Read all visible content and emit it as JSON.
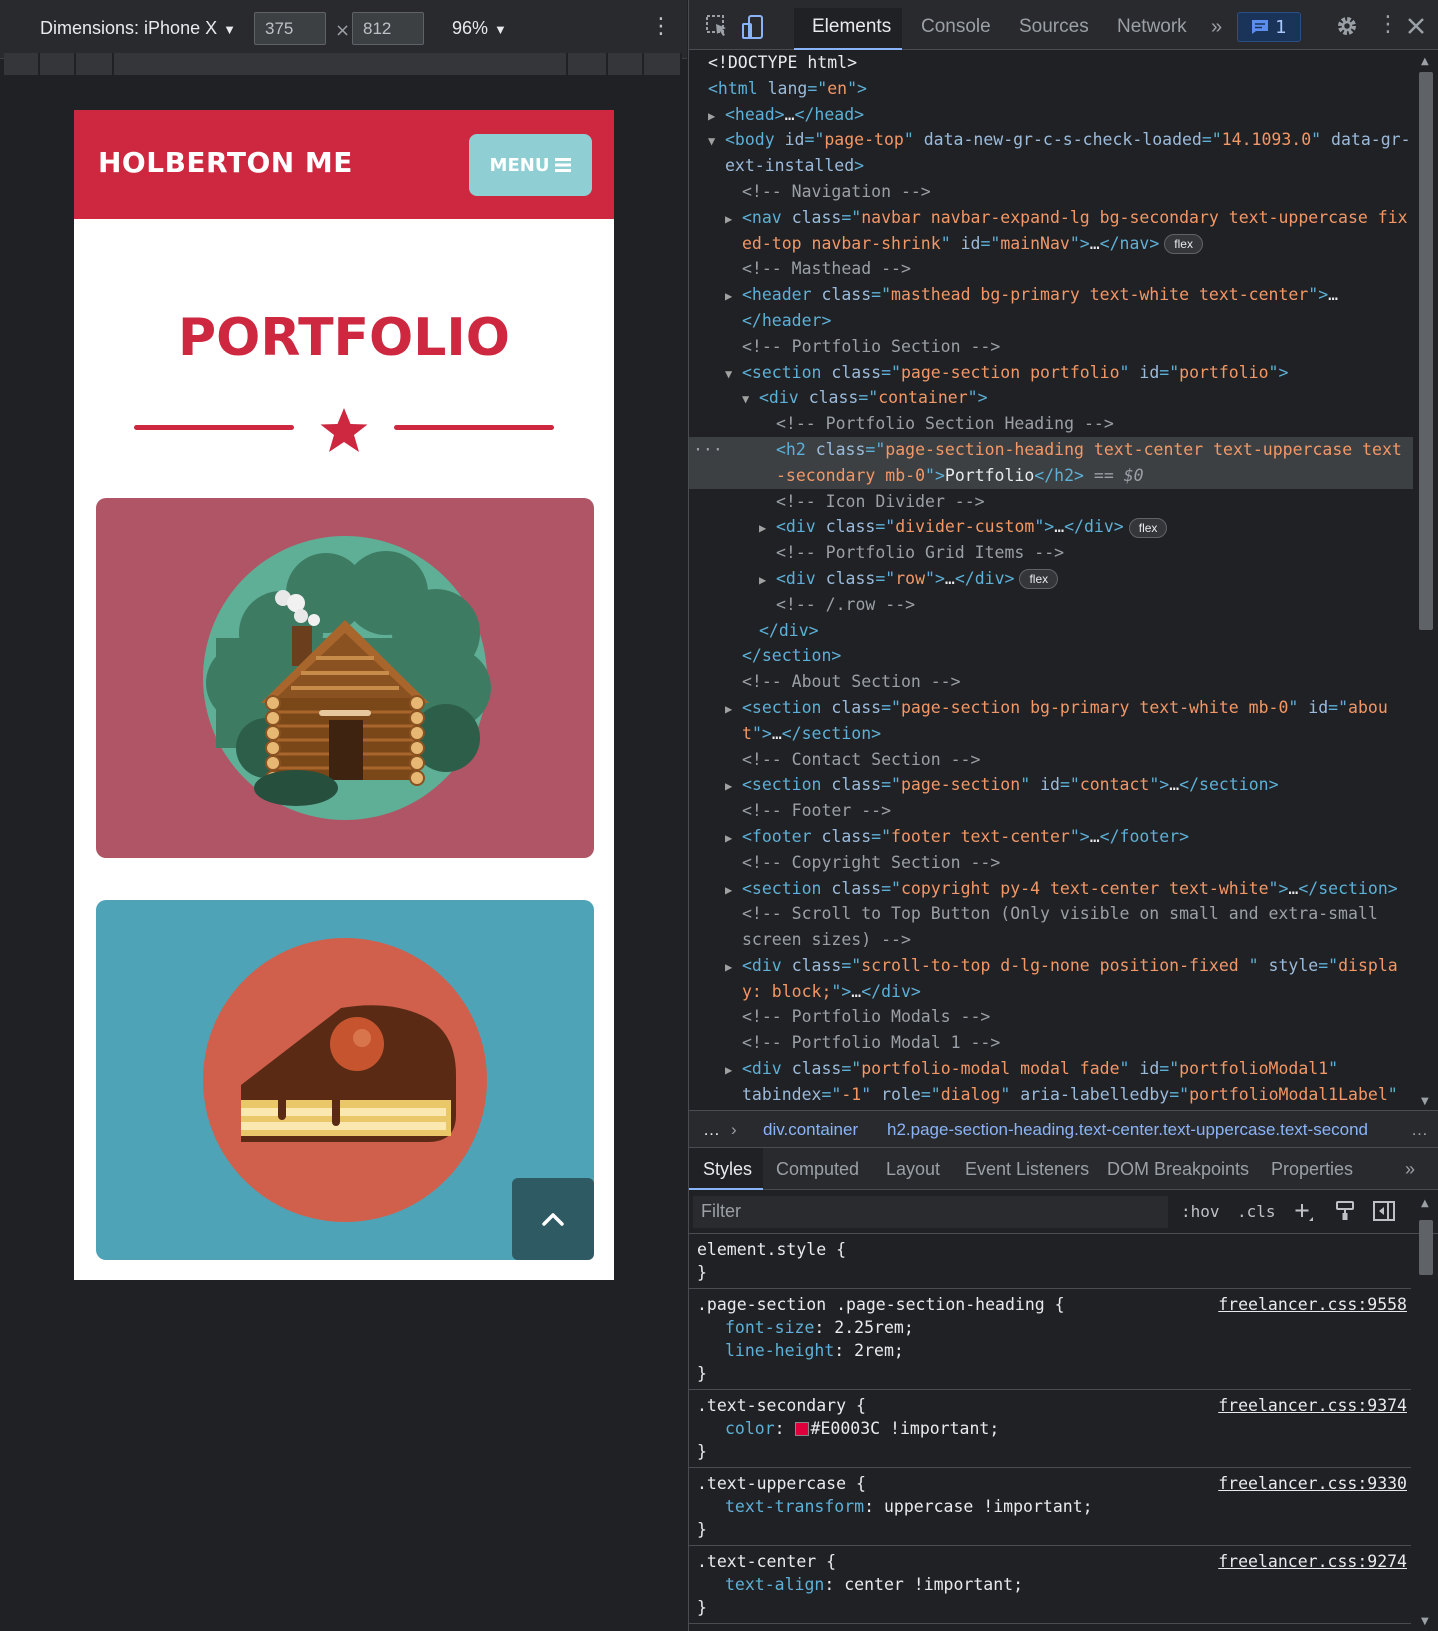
{
  "device_toolbar": {
    "device_label": "Dimensions: iPhone X",
    "width": "375",
    "height": "812",
    "times": "×",
    "zoom": "96%"
  },
  "site": {
    "brand": "HOLBERTON ME",
    "menu_label": "MENU",
    "heading": "PORTFOLIO",
    "colors": {
      "primary": "#cd283f",
      "menu_btn": "#8fcfd3",
      "card1": "#b05565",
      "card2": "#4ea3b6"
    },
    "cards": [
      {
        "name": "cabin",
        "icon": "log-cabin-illustration"
      },
      {
        "name": "cake",
        "icon": "cake-slice-illustration"
      }
    ]
  },
  "devtools": {
    "tabs": [
      "Elements",
      "Console",
      "Sources",
      "Network"
    ],
    "more": "»",
    "messages_count": "1",
    "dom_lines": [
      {
        "indent": 1,
        "arrow": "",
        "html": "<span class=\"tx\">&lt;!DOCTYPE html&gt;</span>"
      },
      {
        "indent": 1,
        "arrow": "",
        "html": "<span class=\"tg\">&lt;html</span> <span class=\"an\">lang</span><span class=\"tg\">=\"</span><span class=\"av\">en</span><span class=\"tg\">\"&gt;</span>"
      },
      {
        "indent": 2,
        "arrow": "▶",
        "html": "<span class=\"tg\">&lt;head&gt;</span>…<span class=\"tg\">&lt;/head&gt;</span>"
      },
      {
        "indent": 2,
        "arrow": "▼",
        "html": "<span class=\"tg\">&lt;body</span> <span class=\"an\">id</span><span class=\"tg\">=\"</span><span class=\"av\">page-top</span><span class=\"tg\">\"</span> <span class=\"an\">data-new-gr-c-s-check-loaded</span><span class=\"tg\">=\"</span><span class=\"av\">14.1093.0</span><span class=\"tg\">\"</span> <span class=\"an\">data-gr-</span>"
      },
      {
        "indent": 2,
        "arrow": "",
        "html": "<span class=\"an\">ext-installed</span><span class=\"tg\">&gt;</span>"
      },
      {
        "indent": 3,
        "arrow": "",
        "html": "<span class=\"cm\">&lt;!-- Navigation --&gt;</span>"
      },
      {
        "indent": 3,
        "arrow": "▶",
        "html": "<span class=\"tg\">&lt;nav</span> <span class=\"an\">class</span><span class=\"tg\">=\"</span><span class=\"av\">navbar navbar-expand-lg bg-secondary text-uppercase fix</span>"
      },
      {
        "indent": 3,
        "arrow": "",
        "html": "<span class=\"av\">ed-top navbar-shrink</span><span class=\"tg\">\"</span> <span class=\"an\">id</span><span class=\"tg\">=\"</span><span class=\"av\">mainNav</span><span class=\"tg\">\"&gt;</span>…<span class=\"tg\">&lt;/nav&gt;</span><span class=\"flex-badge\">flex</span>"
      },
      {
        "indent": 3,
        "arrow": "",
        "html": "<span class=\"cm\">&lt;!-- Masthead --&gt;</span>"
      },
      {
        "indent": 3,
        "arrow": "▶",
        "html": "<span class=\"tg\">&lt;header</span> <span class=\"an\">class</span><span class=\"tg\">=\"</span><span class=\"av\">masthead bg-primary text-white text-center</span><span class=\"tg\">\"&gt;</span>…"
      },
      {
        "indent": 3,
        "arrow": "",
        "html": "<span class=\"tg\">&lt;/header&gt;</span>"
      },
      {
        "indent": 3,
        "arrow": "",
        "html": "<span class=\"cm\">&lt;!-- Portfolio Section --&gt;</span>"
      },
      {
        "indent": 3,
        "arrow": "▼",
        "html": "<span class=\"tg\">&lt;section</span> <span class=\"an\">class</span><span class=\"tg\">=\"</span><span class=\"av\">page-section portfolio</span><span class=\"tg\">\"</span> <span class=\"an\">id</span><span class=\"tg\">=\"</span><span class=\"av\">portfolio</span><span class=\"tg\">\"&gt;</span>"
      },
      {
        "indent": 4,
        "arrow": "▼",
        "html": "<span class=\"tg\">&lt;div</span> <span class=\"an\">class</span><span class=\"tg\">=\"</span><span class=\"av\">container</span><span class=\"tg\">\"&gt;</span>"
      },
      {
        "indent": 5,
        "arrow": "",
        "html": "<span class=\"cm\">&lt;!-- Portfolio Section Heading --&gt;</span>"
      },
      {
        "indent": 5,
        "arrow": "",
        "sel": true,
        "html": "<span class=\"tg\">&lt;h2</span> <span class=\"an\">class</span><span class=\"tg\">=\"</span><span class=\"av\">page-section-heading text-center text-uppercase text</span>"
      },
      {
        "indent": 5,
        "arrow": "",
        "sel": true,
        "html": "<span class=\"av\">-secondary mb-0</span><span class=\"tg\">\"&gt;</span><span class=\"tx\">Portfolio</span><span class=\"tg\">&lt;/h2&gt;</span> <span class=\"cm\">== </span><span class=\"cm\" style=\"font-style:italic\">$0</span>"
      },
      {
        "indent": 5,
        "arrow": "",
        "html": "<span class=\"cm\">&lt;!-- Icon Divider --&gt;</span>"
      },
      {
        "indent": 5,
        "arrow": "▶",
        "html": "<span class=\"tg\">&lt;div</span> <span class=\"an\">class</span><span class=\"tg\">=\"</span><span class=\"av\">divider-custom</span><span class=\"tg\">\"&gt;</span>…<span class=\"tg\">&lt;/div&gt;</span><span class=\"flex-badge\">flex</span>"
      },
      {
        "indent": 5,
        "arrow": "",
        "html": "<span class=\"cm\">&lt;!-- Portfolio Grid Items --&gt;</span>"
      },
      {
        "indent": 5,
        "arrow": "▶",
        "html": "<span class=\"tg\">&lt;div</span> <span class=\"an\">class</span><span class=\"tg\">=\"</span><span class=\"av\">row</span><span class=\"tg\">\"&gt;</span>…<span class=\"tg\">&lt;/div&gt;</span><span class=\"flex-badge\">flex</span>"
      },
      {
        "indent": 5,
        "arrow": "",
        "html": "<span class=\"cm\">&lt;!-- /.row --&gt;</span>"
      },
      {
        "indent": 4,
        "arrow": "",
        "html": "<span class=\"tg\">&lt;/div&gt;</span>"
      },
      {
        "indent": 3,
        "arrow": "",
        "html": "<span class=\"tg\">&lt;/section&gt;</span>"
      },
      {
        "indent": 3,
        "arrow": "",
        "html": "<span class=\"cm\">&lt;!-- About Section --&gt;</span>"
      },
      {
        "indent": 3,
        "arrow": "▶",
        "html": "<span class=\"tg\">&lt;section</span> <span class=\"an\">class</span><span class=\"tg\">=\"</span><span class=\"av\">page-section bg-primary text-white mb-0</span><span class=\"tg\">\"</span> <span class=\"an\">id</span><span class=\"tg\">=\"</span><span class=\"av\">abou</span>"
      },
      {
        "indent": 3,
        "arrow": "",
        "html": "<span class=\"av\">t</span><span class=\"tg\">\"&gt;</span>…<span class=\"tg\">&lt;/section&gt;</span>"
      },
      {
        "indent": 3,
        "arrow": "",
        "html": "<span class=\"cm\">&lt;!-- Contact Section --&gt;</span>"
      },
      {
        "indent": 3,
        "arrow": "▶",
        "html": "<span class=\"tg\">&lt;section</span> <span class=\"an\">class</span><span class=\"tg\">=\"</span><span class=\"av\">page-section</span><span class=\"tg\">\"</span> <span class=\"an\">id</span><span class=\"tg\">=\"</span><span class=\"av\">contact</span><span class=\"tg\">\"&gt;</span>…<span class=\"tg\">&lt;/section&gt;</span>"
      },
      {
        "indent": 3,
        "arrow": "",
        "html": "<span class=\"cm\">&lt;!-- Footer --&gt;</span>"
      },
      {
        "indent": 3,
        "arrow": "▶",
        "html": "<span class=\"tg\">&lt;footer</span> <span class=\"an\">class</span><span class=\"tg\">=\"</span><span class=\"av\">footer text-center</span><span class=\"tg\">\"&gt;</span>…<span class=\"tg\">&lt;/footer&gt;</span>"
      },
      {
        "indent": 3,
        "arrow": "",
        "html": "<span class=\"cm\">&lt;!-- Copyright Section --&gt;</span>"
      },
      {
        "indent": 3,
        "arrow": "▶",
        "html": "<span class=\"tg\">&lt;section</span> <span class=\"an\">class</span><span class=\"tg\">=\"</span><span class=\"av\">copyright py-4 text-center text-white</span><span class=\"tg\">\"&gt;</span>…<span class=\"tg\">&lt;/section&gt;</span>"
      },
      {
        "indent": 3,
        "arrow": "",
        "html": "<span class=\"cm\">&lt;!-- Scroll to Top Button (Only visible on small and extra-small</span>"
      },
      {
        "indent": 3,
        "arrow": "",
        "html": "<span class=\"cm\">screen sizes) --&gt;</span>"
      },
      {
        "indent": 3,
        "arrow": "▶",
        "html": "<span class=\"tg\">&lt;div</span> <span class=\"an\">class</span><span class=\"tg\">=\"</span><span class=\"av\">scroll-to-top d-lg-none position-fixed </span><span class=\"tg\">\"</span> <span class=\"an\">style</span><span class=\"tg\">=\"</span><span class=\"av\">displa</span>"
      },
      {
        "indent": 3,
        "arrow": "",
        "html": "<span class=\"av\">y: block;</span><span class=\"tg\">\"&gt;</span>…<span class=\"tg\">&lt;/div&gt;</span>"
      },
      {
        "indent": 3,
        "arrow": "",
        "html": "<span class=\"cm\">&lt;!-- Portfolio Modals --&gt;</span>"
      },
      {
        "indent": 3,
        "arrow": "",
        "html": "<span class=\"cm\">&lt;!-- Portfolio Modal 1 --&gt;</span>"
      },
      {
        "indent": 3,
        "arrow": "▶",
        "html": "<span class=\"tg\">&lt;div</span> <span class=\"an\">class</span><span class=\"tg\">=\"</span><span class=\"av\">portfolio-modal modal fade</span><span class=\"tg\">\"</span> <span class=\"an\">id</span><span class=\"tg\">=\"</span><span class=\"av\">portfolioModal1</span><span class=\"tg\">\"</span>"
      },
      {
        "indent": 3,
        "arrow": "",
        "html": "<span class=\"an\">tabindex</span><span class=\"tg\">=\"</span><span class=\"av\">-1</span><span class=\"tg\">\"</span> <span class=\"an\">role</span><span class=\"tg\">=\"</span><span class=\"av\">dialog</span><span class=\"tg\">\"</span> <span class=\"an\">aria-labelledby</span><span class=\"tg\">=\"</span><span class=\"av\">portfolioModal1Label</span><span class=\"tg\">\"</span>"
      }
    ],
    "breadcrumbs": [
      "…",
      "›",
      "div.container",
      "h2.page-section-heading.text-center.text-uppercase.text-second",
      "…"
    ],
    "style_tabs": [
      "Styles",
      "Computed",
      "Layout",
      "Event Listeners",
      "DOM Breakpoints",
      "Properties",
      "»"
    ],
    "filter_placeholder": "Filter",
    "hov": ":hov",
    "cls": ".cls",
    "rules": [
      {
        "selector": "element.style {",
        "source": "",
        "props": [],
        "close": "}"
      },
      {
        "selector": ".page-section .page-section-heading {",
        "source": "freelancer.css:9558",
        "props": [
          {
            "n": "font-size",
            "v": "2.25rem;"
          },
          {
            "n": "line-height",
            "v": "2rem;"
          }
        ],
        "close": "}"
      },
      {
        "selector": ".text-secondary {",
        "source": "freelancer.css:9374",
        "props": [
          {
            "n": "color",
            "v": "#E0003C !important;",
            "swatch": "#e0003c"
          }
        ],
        "close": "}"
      },
      {
        "selector": ".text-uppercase {",
        "source": "freelancer.css:9330",
        "props": [
          {
            "n": "text-transform",
            "v": "uppercase !important;"
          }
        ],
        "close": "}"
      },
      {
        "selector": ".text-center {",
        "source": "freelancer.css:9274",
        "props": [
          {
            "n": "text-align",
            "v": "center !important;"
          }
        ],
        "close": "}"
      }
    ]
  }
}
